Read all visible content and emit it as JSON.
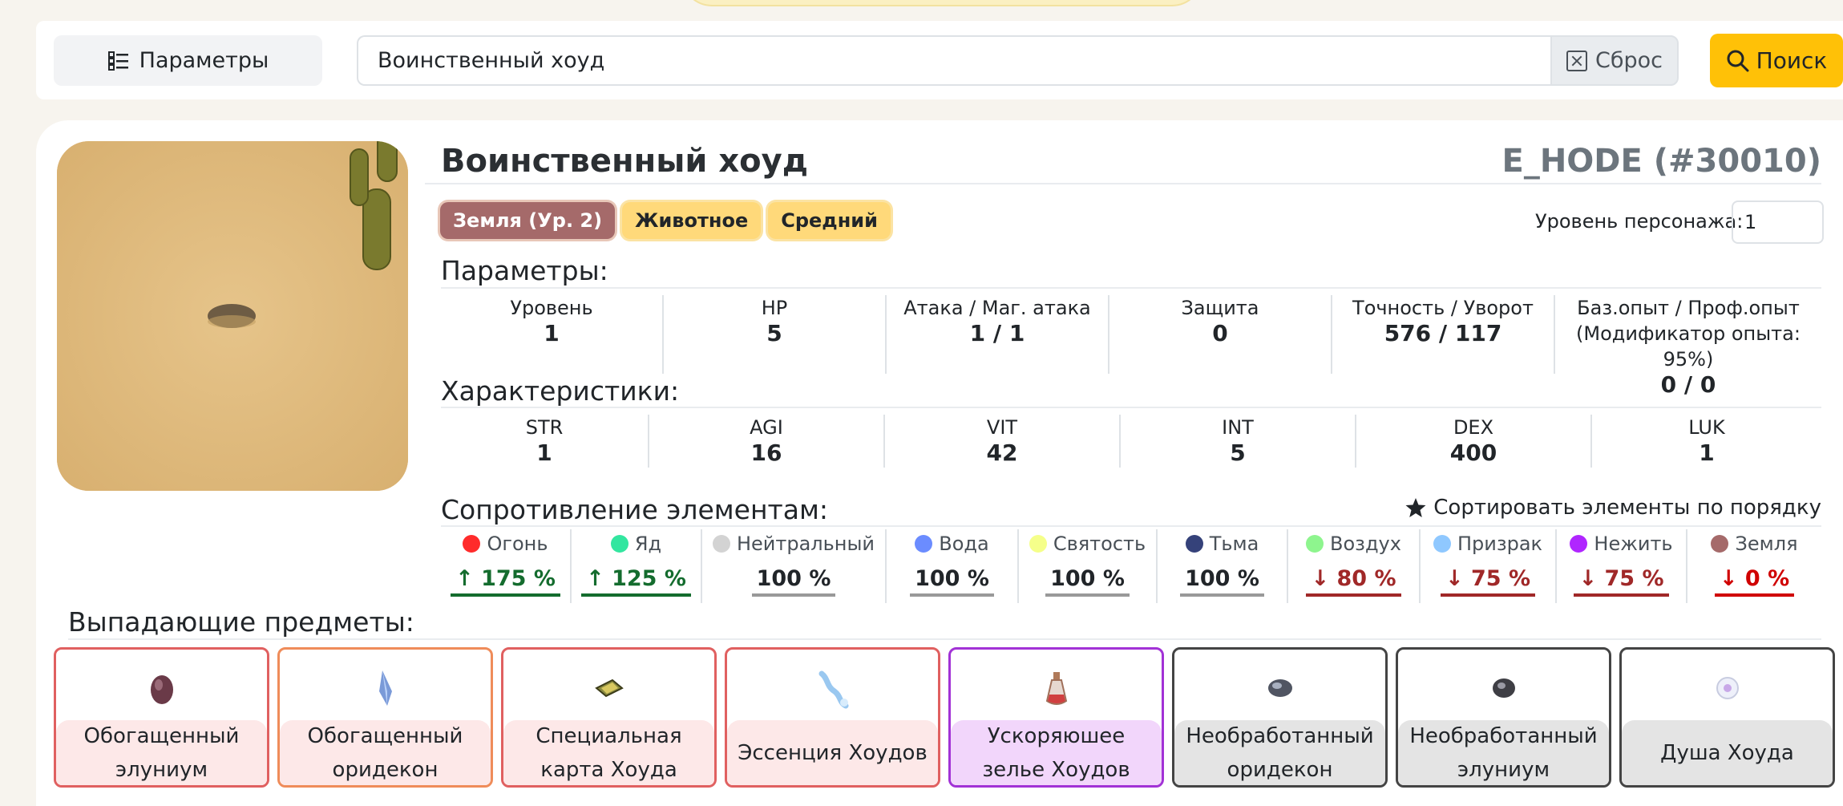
{
  "search": {
    "params_label": "Параметры",
    "value": "Воинственный хоуд",
    "reset_label": "Сброс",
    "search_label": "Поиск"
  },
  "monster": {
    "name": "Воинственный хоуд",
    "id_label": "E_HODE (#30010)",
    "badges": {
      "element": "Земля (Ур. 2)",
      "race": "Животное",
      "size": "Средний"
    },
    "char_level_label": "Уровень персонажа:",
    "char_level_value": "1"
  },
  "params": {
    "title": "Параметры:",
    "cells": [
      {
        "label": "Уровень",
        "value": "1"
      },
      {
        "label": "HP",
        "value": "5"
      },
      {
        "label": "Атака / Маг. атака",
        "value": "1 / 1"
      },
      {
        "label": "Защита",
        "value": "0"
      },
      {
        "label": "Точность / Уворот",
        "value": "576 / 117"
      },
      {
        "label": "Баз.опыт / Проф.опыт",
        "label2": "(Модификатор опыта: 95%)",
        "value": "0 / 0"
      }
    ]
  },
  "stats": {
    "title": "Характеристики:",
    "cells": [
      {
        "label": "STR",
        "value": "1"
      },
      {
        "label": "AGI",
        "value": "16"
      },
      {
        "label": "VIT",
        "value": "42"
      },
      {
        "label": "INT",
        "value": "5"
      },
      {
        "label": "DEX",
        "value": "400"
      },
      {
        "label": "LUK",
        "value": "1"
      }
    ]
  },
  "elements": {
    "title": "Сопротивление элементам:",
    "sort_label": "Сортировать элементы по порядку",
    "items": [
      {
        "name": "Огонь",
        "value": "↑ 175 %",
        "color": "#ff2b2b"
      },
      {
        "name": "Яд",
        "value": "↑ 125 %",
        "color": "#33e6a0"
      },
      {
        "name": "Нейтральный",
        "value": "100 %",
        "color": "#d3d3d3"
      },
      {
        "name": "Вода",
        "value": "100 %",
        "color": "#6b8cff"
      },
      {
        "name": "Святость",
        "value": "100 %",
        "color": "#f5ff8a"
      },
      {
        "name": "Тьма",
        "value": "100 %",
        "color": "#35427a"
      },
      {
        "name": "Воздух",
        "value": "↓ 80 %",
        "color": "#8ef58e"
      },
      {
        "name": "Призрак",
        "value": "↓ 75 %",
        "color": "#8fc8ff"
      },
      {
        "name": "Нежить",
        "value": "↓ 75 %",
        "color": "#b026ff"
      },
      {
        "name": "Земля",
        "value": "↓ 0 %",
        "color": "#a56a6a"
      }
    ]
  },
  "drops": {
    "title": "Выпадающие предметы:",
    "items": [
      {
        "label": "Обогащенный элуниум",
        "icon": "elunium-icon"
      },
      {
        "label": "Обогащенный оридекон",
        "icon": "oridecon-icon"
      },
      {
        "label": "Специальная карта Хоуда",
        "icon": "card-icon"
      },
      {
        "label": "Эссенция Хоудов",
        "icon": "essence-icon"
      },
      {
        "label": "Ускоряюшее зелье Хоудов",
        "icon": "potion-icon"
      },
      {
        "label": "Необработанный оридекон",
        "icon": "rough-oridecon-icon"
      },
      {
        "label": "Необработанный элуниум",
        "icon": "rough-elunium-icon"
      },
      {
        "label": "Душа Хоуда",
        "icon": "soul-icon"
      }
    ]
  }
}
